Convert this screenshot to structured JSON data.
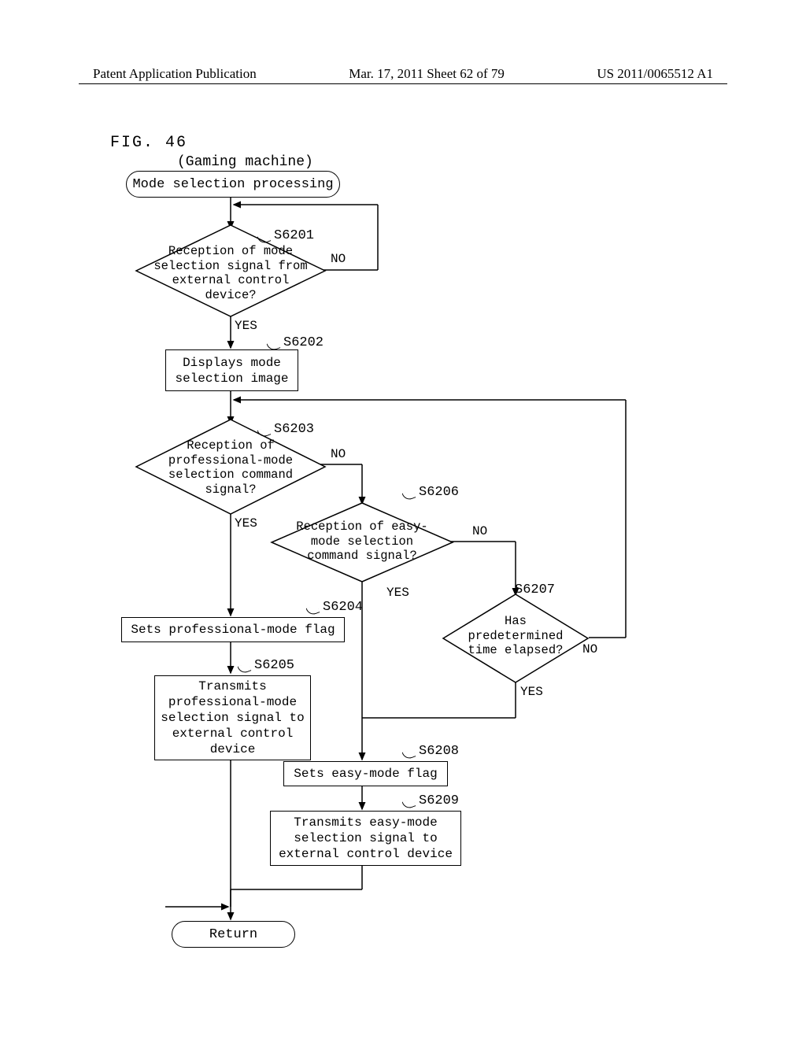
{
  "header": {
    "left": "Patent Application Publication",
    "center": "Mar. 17, 2011  Sheet 62 of 79",
    "right": "US 2011/0065512 A1"
  },
  "figure": {
    "label": "FIG. 46",
    "context": "(Gaming machine)",
    "start": "Mode selection processing",
    "end": "Return"
  },
  "steps": {
    "s6201": {
      "id": "S6201",
      "text": "Reception of mode selection signal from external control device?"
    },
    "s6202": {
      "id": "S6202",
      "text": "Displays mode selection image"
    },
    "s6203": {
      "id": "S6203",
      "text": "Reception of professional-mode selection command signal?"
    },
    "s6204": {
      "id": "S6204",
      "text": "Sets professional-mode flag"
    },
    "s6205": {
      "id": "S6205",
      "text": "Transmits professional-mode selection signal to external control device"
    },
    "s6206": {
      "id": "S6206",
      "text": "Reception of easy-mode selection command signal?"
    },
    "s6207": {
      "id": "S6207",
      "text": "Has predetermined time elapsed?"
    },
    "s6208": {
      "id": "S6208",
      "text": "Sets easy-mode flag"
    },
    "s6209": {
      "id": "S6209",
      "text": "Transmits easy-mode selection signal to external control device"
    }
  },
  "labels": {
    "yes": "YES",
    "no": "NO"
  }
}
